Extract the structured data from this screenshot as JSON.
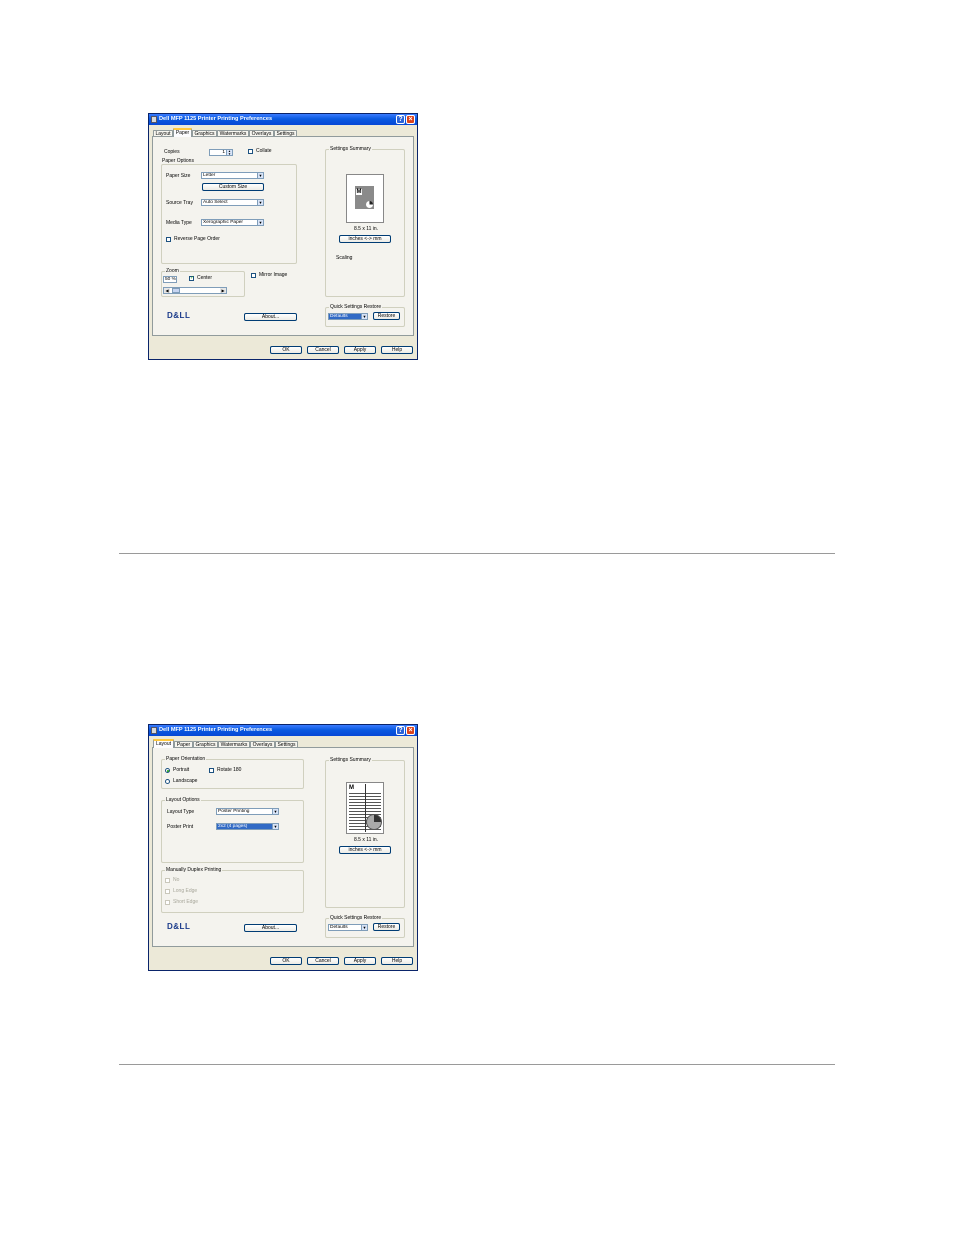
{
  "dialog_paper": {
    "title": "Dell MFP 1125 Printer Printing Preferences",
    "tabs": [
      "Layout",
      "Paper",
      "Graphics",
      "Watermarks",
      "Overlays",
      "Settings"
    ],
    "active_tab": "Paper",
    "copies_label": "Copies",
    "copies_value": "1",
    "collate_label": "Collate",
    "paper_options_label": "Paper Options",
    "paper_size_label": "Paper Size",
    "paper_size_value": "Letter",
    "custom_size_label": "Custom Size",
    "source_tray_label": "Source Tray",
    "source_tray_value": "Auto Select",
    "media_type_label": "Media Type",
    "media_type_value": "Xerographic Paper",
    "reverse_page_order_label": "Reverse Page Order",
    "zoom_label": "Zoom",
    "zoom_value": "50 %",
    "center_label": "Center",
    "mirror_image_label": "Mirror Image",
    "settings_summary_label": "Settings Summary",
    "page_letter": "M",
    "paper_dims": "8.5 x 11 in.",
    "units_button": "inches <-> mm",
    "scaling_label": "Scaling",
    "quick_settings_label": "Quick Settings Restore",
    "quick_settings_value": "Defaults",
    "restore_label": "Restore",
    "logo_text": "D&LL",
    "about_label": "About...",
    "ok_label": "OK",
    "cancel_label": "Cancel",
    "apply_label": "Apply",
    "help_label": "Help"
  },
  "dialog_layout": {
    "title": "Dell MFP 1125 Printer Printing Preferences",
    "tabs": [
      "Layout",
      "Paper",
      "Graphics",
      "Watermarks",
      "Overlays",
      "Settings"
    ],
    "active_tab": "Layout",
    "paper_orientation_label": "Paper Orientation",
    "portrait_label": "Portrait",
    "landscape_label": "Landscape",
    "rotate_label": "Rotate 180",
    "layout_options_label": "Layout Options",
    "layout_type_label": "Layout Type",
    "layout_type_value": "Poster Printing",
    "poster_print_label": "Poster Print",
    "poster_print_value": "2x2 (4 pages)",
    "manual_duplex_label": "Manually Duplex Printing",
    "duplex_none": "No",
    "duplex_long": "Long Edge",
    "duplex_short": "Short Edge",
    "settings_summary_label": "Settings Summary",
    "page_letter": "M",
    "paper_dims": "8.5 x 11 in.",
    "units_button": "inches <-> mm",
    "quick_settings_label": "Quick Settings Restore",
    "quick_settings_value": "Defaults",
    "restore_label": "Restore",
    "logo_text": "D&LL",
    "about_label": "About...",
    "ok_label": "OK",
    "cancel_label": "Cancel",
    "apply_label": "Apply",
    "help_label": "Help"
  }
}
